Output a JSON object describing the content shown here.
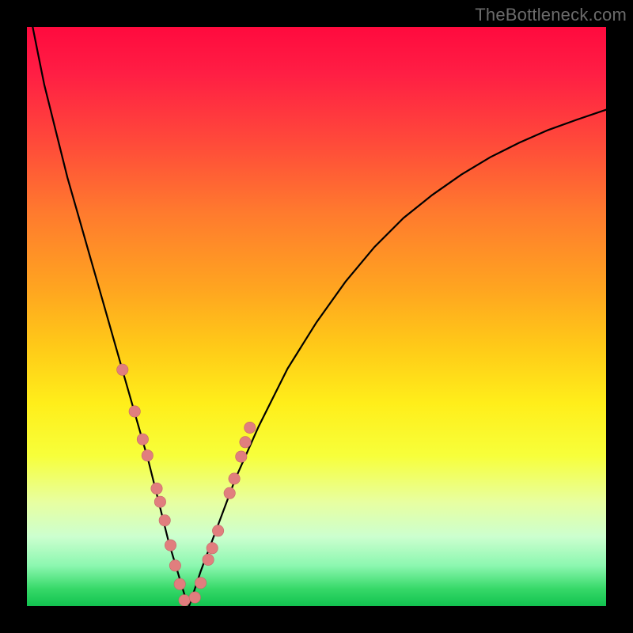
{
  "watermark": {
    "text": "TheBottleneck.com"
  },
  "colors": {
    "curve_stroke": "#000000",
    "marker_fill": "#e17e7e",
    "marker_stroke": "#c46868",
    "background": "#000000"
  },
  "chart_data": {
    "type": "line",
    "title": "",
    "xlabel": "",
    "ylabel": "",
    "xlim": [
      0,
      100
    ],
    "ylim": [
      0,
      100
    ],
    "grid": false,
    "series": [
      {
        "name": "bottleneck-curve",
        "x": [
          0,
          1,
          2,
          3,
          5,
          7,
          9,
          11,
          13,
          15,
          17,
          19,
          21,
          23,
          24.5,
          26,
          27.2,
          28,
          30,
          33,
          36,
          40,
          45,
          50,
          55,
          60,
          65,
          70,
          75,
          80,
          85,
          90,
          95,
          100
        ],
        "values": [
          105,
          100,
          95,
          90,
          82,
          74,
          67,
          60,
          53,
          46,
          39,
          32,
          25,
          17,
          11,
          6,
          2,
          0,
          6,
          14,
          22,
          31,
          41,
          49,
          56,
          62,
          67,
          71,
          74.5,
          77.5,
          80,
          82.2,
          84,
          85.7
        ]
      }
    ],
    "markers": {
      "name": "highlighted-points",
      "x_percent": [
        16.5,
        18.6,
        20.0,
        20.8,
        22.4,
        23.0,
        23.8,
        24.8,
        25.6,
        26.4,
        27.2,
        29.0,
        30.0,
        31.3,
        32.0,
        33.0,
        35.0,
        35.8,
        37.0,
        37.7,
        38.5
      ],
      "y_percent": [
        40.8,
        33.6,
        28.8,
        26.0,
        20.3,
        18.0,
        14.8,
        10.5,
        7.0,
        3.8,
        1.0,
        1.5,
        4.0,
        8.0,
        10.0,
        13.0,
        19.5,
        22.0,
        25.8,
        28.3,
        30.8
      ]
    }
  }
}
